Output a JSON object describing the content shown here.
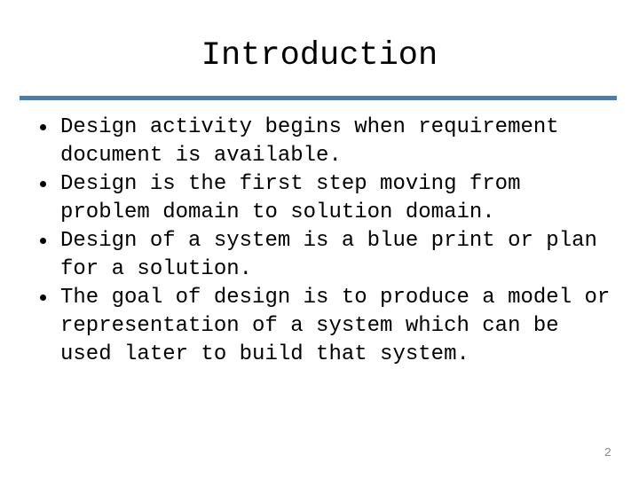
{
  "slide": {
    "title": "Introduction",
    "divider_color": "#4f7ca5",
    "background_color": "#ffffff",
    "text_color": "#000000",
    "page_number": "2",
    "page_number_color": "#8a8a8a",
    "bullets": [
      {
        "marker": "bullet-dot",
        "text": "Design activity begins when requirement document is available."
      },
      {
        "marker": "bullet-dot",
        "text": "Design is the first step moving from problem domain to solution domain."
      },
      {
        "marker": "bullet-dot",
        "text": "Design of a system is a blue print or plan for a solution."
      },
      {
        "marker": "bullet-dot",
        "text": "The goal of design is to produce a model or representation of a system which can be used later to build that system."
      }
    ]
  }
}
